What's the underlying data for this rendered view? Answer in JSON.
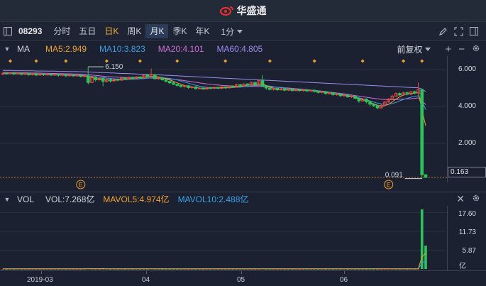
{
  "app": {
    "brand": "华盛通"
  },
  "toolbar": {
    "stock_code": "08293",
    "periods": [
      "分时",
      "五日",
      "日K",
      "周K",
      "月K",
      "季K",
      "年K"
    ],
    "period_select": "1分"
  },
  "main_legend": {
    "name": "MA",
    "ma5": "MA5:2.949",
    "ma10": "MA10:3.823",
    "ma20": "MA20:4.101",
    "ma60": "MA60:4.805",
    "adjust": "前复权"
  },
  "price_axis": [
    "6.000",
    "4.000",
    "2.000"
  ],
  "current_price": "0.163",
  "annotations": {
    "high": "6.150",
    "low": "0.091",
    "event_marker": "E"
  },
  "vol_legend": {
    "name": "VOL",
    "vol": "VOL:7.268亿",
    "mavol5": "MAVOL5:4.974亿",
    "mavol10": "MAVOL10:2.488亿"
  },
  "vol_axis": [
    "17.60",
    "11.73",
    "5.87",
    "亿"
  ],
  "time_axis": [
    "2019-03",
    "04",
    "05",
    "06"
  ],
  "colors": {
    "up": "#e04848",
    "down": "#2fc25b",
    "ma5": "#f0a030",
    "ma10": "#3aa0e8",
    "ma20": "#d070d8",
    "ma60": "#9b8cf0",
    "marker": "#f0a030"
  },
  "chart_data": {
    "type": "candlestick",
    "ylim": [
      0,
      6.5
    ],
    "candles": [
      [
        5.75,
        5.8,
        5.85,
        5.7
      ],
      [
        5.8,
        5.78,
        5.88,
        5.72
      ],
      [
        5.78,
        5.82,
        5.86,
        5.74
      ],
      [
        5.82,
        5.76,
        5.86,
        5.7
      ],
      [
        5.76,
        5.8,
        5.84,
        5.72
      ],
      [
        5.8,
        5.74,
        5.84,
        5.68
      ],
      [
        5.74,
        5.79,
        5.83,
        5.7
      ],
      [
        5.79,
        5.72,
        5.82,
        5.66
      ],
      [
        5.72,
        5.78,
        5.82,
        5.68
      ],
      [
        5.78,
        5.7,
        5.82,
        5.64
      ],
      [
        5.7,
        5.76,
        5.8,
        5.66
      ],
      [
        5.76,
        5.72,
        5.8,
        5.66
      ],
      [
        5.72,
        5.74,
        5.78,
        5.68
      ],
      [
        5.74,
        5.7,
        5.78,
        5.64
      ],
      [
        5.7,
        5.73,
        5.76,
        5.66
      ],
      [
        5.73,
        5.69,
        5.78,
        5.62
      ],
      [
        5.69,
        5.72,
        5.76,
        5.64
      ],
      [
        5.72,
        5.66,
        5.76,
        5.6
      ],
      [
        5.66,
        5.7,
        5.74,
        5.62
      ],
      [
        5.7,
        5.67,
        5.74,
        5.6
      ],
      [
        5.67,
        5.69,
        5.72,
        5.62
      ],
      [
        5.69,
        5.62,
        5.72,
        5.58
      ],
      [
        5.62,
        5.66,
        5.7,
        5.58
      ],
      [
        5.66,
        5.3,
        6.15,
        5.2
      ],
      [
        5.3,
        5.6,
        5.66,
        5.28
      ],
      [
        5.6,
        5.44,
        5.64,
        5.36
      ],
      [
        5.44,
        5.52,
        5.58,
        5.4
      ],
      [
        5.52,
        5.36,
        5.56,
        5.1
      ],
      [
        5.36,
        5.46,
        5.5,
        5.3
      ],
      [
        5.46,
        5.38,
        5.52,
        5.3
      ],
      [
        5.38,
        5.46,
        5.5,
        5.34
      ],
      [
        5.46,
        5.42,
        5.52,
        5.36
      ],
      [
        5.42,
        5.54,
        5.58,
        5.4
      ],
      [
        5.54,
        5.48,
        5.58,
        5.42
      ],
      [
        5.48,
        5.58,
        5.62,
        5.44
      ],
      [
        5.58,
        5.52,
        5.62,
        5.46
      ],
      [
        5.52,
        5.6,
        5.64,
        5.48
      ],
      [
        5.6,
        5.54,
        5.64,
        5.5
      ],
      [
        5.54,
        5.7,
        5.74,
        5.52
      ],
      [
        5.7,
        5.6,
        5.76,
        5.56
      ],
      [
        5.6,
        5.72,
        6.05,
        5.58
      ],
      [
        5.72,
        5.5,
        5.76,
        5.46
      ],
      [
        5.5,
        5.56,
        5.6,
        5.44
      ],
      [
        5.56,
        5.44,
        5.6,
        5.4
      ],
      [
        5.44,
        5.36,
        5.48,
        5.3
      ],
      [
        5.36,
        5.28,
        5.4,
        5.22
      ],
      [
        5.28,
        5.2,
        5.32,
        5.16
      ],
      [
        5.2,
        5.14,
        5.24,
        5.08
      ],
      [
        5.14,
        5.08,
        5.18,
        5.02
      ],
      [
        5.08,
        5.12,
        5.16,
        5.02
      ],
      [
        5.12,
        5.02,
        5.16,
        4.96
      ],
      [
        5.02,
        5.06,
        5.1,
        4.96
      ],
      [
        5.06,
        4.96,
        5.1,
        4.92
      ],
      [
        4.96,
        5.0,
        5.04,
        4.92
      ],
      [
        5.0,
        4.94,
        5.04,
        4.9
      ],
      [
        4.94,
        5.02,
        5.06,
        4.9
      ],
      [
        5.02,
        4.98,
        5.06,
        4.92
      ],
      [
        4.98,
        5.04,
        5.08,
        4.94
      ],
      [
        5.04,
        4.98,
        5.08,
        4.94
      ],
      [
        4.98,
        5.06,
        5.1,
        4.94
      ],
      [
        5.06,
        5.0,
        5.1,
        4.96
      ],
      [
        5.0,
        5.1,
        5.14,
        4.98
      ],
      [
        5.1,
        5.04,
        5.14,
        5.0
      ],
      [
        5.04,
        5.18,
        5.22,
        5.02
      ],
      [
        5.18,
        5.1,
        5.22,
        5.04
      ],
      [
        5.1,
        5.22,
        5.26,
        5.06
      ],
      [
        5.22,
        5.14,
        5.26,
        5.1
      ],
      [
        5.14,
        5.3,
        5.34,
        5.12
      ],
      [
        5.3,
        5.16,
        5.34,
        5.12
      ],
      [
        5.16,
        5.4,
        5.46,
        5.14
      ],
      [
        5.4,
        5.1,
        5.7,
        5.06
      ],
      [
        5.1,
        5.0,
        5.14,
        4.9
      ],
      [
        5.0,
        4.92,
        5.06,
        4.86
      ],
      [
        4.92,
        4.98,
        5.02,
        4.86
      ],
      [
        4.98,
        4.9,
        5.02,
        4.84
      ],
      [
        4.9,
        4.96,
        5.0,
        4.86
      ],
      [
        4.96,
        4.88,
        5.0,
        4.82
      ],
      [
        4.88,
        4.94,
        4.98,
        4.84
      ],
      [
        4.94,
        4.86,
        4.98,
        4.8
      ],
      [
        4.86,
        4.92,
        4.96,
        4.82
      ],
      [
        4.92,
        4.86,
        4.96,
        4.8
      ],
      [
        4.86,
        4.9,
        4.94,
        4.8
      ],
      [
        4.9,
        4.84,
        4.94,
        4.78
      ],
      [
        4.84,
        4.88,
        4.92,
        4.78
      ],
      [
        4.88,
        4.82,
        4.92,
        4.76
      ],
      [
        4.82,
        4.76,
        4.86,
        4.7
      ],
      [
        4.76,
        4.8,
        4.84,
        4.7
      ],
      [
        4.8,
        4.7,
        4.84,
        4.64
      ],
      [
        4.7,
        4.74,
        4.78,
        4.64
      ],
      [
        4.74,
        4.64,
        4.78,
        4.58
      ],
      [
        4.64,
        4.68,
        4.72,
        4.58
      ],
      [
        4.68,
        4.58,
        4.72,
        4.52
      ],
      [
        4.58,
        4.62,
        4.66,
        4.52
      ],
      [
        4.62,
        4.52,
        4.66,
        4.46
      ],
      [
        4.52,
        4.56,
        4.6,
        4.46
      ],
      [
        4.56,
        4.44,
        4.6,
        4.38
      ],
      [
        4.44,
        4.3,
        4.48,
        4.2
      ],
      [
        4.3,
        4.4,
        4.46,
        4.26
      ],
      [
        4.4,
        4.26,
        4.44,
        4.16
      ],
      [
        4.26,
        4.12,
        4.32,
        4.02
      ],
      [
        4.12,
        4.04,
        4.18,
        3.96
      ],
      [
        4.04,
        3.92,
        4.1,
        3.86
      ],
      [
        3.92,
        4.06,
        4.12,
        3.88
      ],
      [
        4.06,
        4.24,
        4.3,
        4.02
      ],
      [
        4.24,
        4.4,
        4.46,
        4.2
      ],
      [
        4.4,
        4.56,
        4.62,
        4.36
      ],
      [
        4.56,
        4.7,
        4.76,
        4.52
      ],
      [
        4.7,
        4.62,
        4.76,
        4.58
      ],
      [
        4.62,
        4.74,
        4.8,
        4.58
      ],
      [
        4.74,
        4.66,
        4.8,
        4.6
      ],
      [
        4.66,
        4.8,
        4.84,
        4.62
      ],
      [
        4.8,
        4.72,
        4.86,
        4.66
      ],
      [
        4.72,
        4.9,
        5.3,
        4.68
      ],
      [
        4.9,
        0.3,
        4.96,
        0.091
      ],
      [
        0.3,
        0.163,
        0.32,
        0.12
      ]
    ],
    "ma5": [
      5.78,
      5.78,
      5.78,
      5.78,
      5.78,
      5.77,
      5.76,
      5.75,
      5.75,
      5.74,
      5.74,
      5.73,
      5.73,
      5.72,
      5.72,
      5.71,
      5.71,
      5.7,
      5.7,
      5.69,
      5.68,
      5.67,
      5.66,
      5.6,
      5.56,
      5.52,
      5.48,
      5.45,
      5.43,
      5.42,
      5.42,
      5.44,
      5.46,
      5.48,
      5.5,
      5.53,
      5.55,
      5.58,
      5.6,
      5.62,
      5.64,
      5.63,
      5.6,
      5.56,
      5.5,
      5.44,
      5.36,
      5.28,
      5.2,
      5.14,
      5.1,
      5.06,
      5.03,
      5.0,
      4.99,
      4.99,
      5.0,
      5.01,
      5.02,
      5.02,
      5.03,
      5.04,
      5.06,
      5.08,
      5.1,
      5.12,
      5.15,
      5.18,
      5.21,
      5.22,
      5.2,
      5.14,
      5.06,
      4.98,
      4.94,
      4.92,
      4.91,
      4.9,
      4.89,
      4.88,
      4.88,
      4.87,
      4.86,
      4.85,
      4.84,
      4.82,
      4.79,
      4.76,
      4.73,
      4.7,
      4.66,
      4.63,
      4.6,
      4.57,
      4.53,
      4.48,
      4.42,
      4.36,
      4.3,
      4.22,
      4.14,
      4.06,
      4.02,
      4.04,
      4.12,
      4.25,
      4.4,
      4.52,
      4.62,
      4.68,
      4.7,
      4.72,
      4.76,
      3.8,
      2.949
    ],
    "ma10": [
      5.8,
      5.8,
      5.79,
      5.79,
      5.79,
      5.78,
      5.78,
      5.77,
      5.77,
      5.76,
      5.76,
      5.75,
      5.75,
      5.74,
      5.74,
      5.73,
      5.73,
      5.72,
      5.72,
      5.71,
      5.71,
      5.7,
      5.69,
      5.66,
      5.63,
      5.6,
      5.58,
      5.56,
      5.54,
      5.52,
      5.5,
      5.48,
      5.47,
      5.46,
      5.46,
      5.47,
      5.48,
      5.5,
      5.51,
      5.53,
      5.55,
      5.56,
      5.56,
      5.55,
      5.54,
      5.52,
      5.48,
      5.44,
      5.38,
      5.32,
      5.26,
      5.2,
      5.15,
      5.1,
      5.07,
      5.04,
      5.02,
      5.01,
      5.01,
      5.01,
      5.01,
      5.02,
      5.03,
      5.04,
      5.05,
      5.07,
      5.09,
      5.11,
      5.13,
      5.14,
      5.14,
      5.12,
      5.1,
      5.07,
      5.04,
      5.02,
      5.0,
      4.98,
      4.96,
      4.94,
      4.92,
      4.91,
      4.9,
      4.88,
      4.86,
      4.85,
      4.82,
      4.8,
      4.77,
      4.74,
      4.71,
      4.67,
      4.64,
      4.6,
      4.56,
      4.52,
      4.47,
      4.42,
      4.36,
      4.3,
      4.24,
      4.18,
      4.14,
      4.12,
      4.12,
      4.16,
      4.22,
      4.3,
      4.38,
      4.44,
      4.5,
      4.54,
      4.58,
      4.3,
      3.823
    ],
    "ma20": [
      5.85,
      5.85,
      5.84,
      5.84,
      5.84,
      5.83,
      5.83,
      5.82,
      5.82,
      5.81,
      5.81,
      5.8,
      5.8,
      5.79,
      5.79,
      5.78,
      5.78,
      5.77,
      5.77,
      5.76,
      5.76,
      5.75,
      5.74,
      5.72,
      5.7,
      5.68,
      5.66,
      5.64,
      5.62,
      5.61,
      5.6,
      5.59,
      5.58,
      5.57,
      5.56,
      5.55,
      5.55,
      5.54,
      5.54,
      5.54,
      5.54,
      5.53,
      5.52,
      5.51,
      5.5,
      5.49,
      5.47,
      5.45,
      5.43,
      5.4,
      5.37,
      5.34,
      5.31,
      5.28,
      5.25,
      5.22,
      5.2,
      5.18,
      5.16,
      5.14,
      5.13,
      5.12,
      5.11,
      5.1,
      5.09,
      5.09,
      5.09,
      5.09,
      5.09,
      5.08,
      5.08,
      5.07,
      5.06,
      5.05,
      5.04,
      5.03,
      5.01,
      5.0,
      4.98,
      4.96,
      4.95,
      4.93,
      4.91,
      4.89,
      4.87,
      4.85,
      4.83,
      4.81,
      4.78,
      4.76,
      4.73,
      4.71,
      4.68,
      4.65,
      4.62,
      4.59,
      4.56,
      4.53,
      4.5,
      4.47,
      4.44,
      4.41,
      4.39,
      4.38,
      4.37,
      4.37,
      4.38,
      4.39,
      4.4,
      4.41,
      4.42,
      4.44,
      4.46,
      4.3,
      4.101
    ],
    "ma60": [
      5.95,
      5.95,
      5.95,
      5.94,
      5.94,
      5.94,
      5.93,
      5.93,
      5.93,
      5.92,
      5.92,
      5.92,
      5.91,
      5.91,
      5.91,
      5.9,
      5.9,
      5.9,
      5.89,
      5.89,
      5.89,
      5.88,
      5.88,
      5.87,
      5.86,
      5.85,
      5.84,
      5.84,
      5.83,
      5.82,
      5.81,
      5.8,
      5.79,
      5.79,
      5.78,
      5.77,
      5.76,
      5.75,
      5.74,
      5.73,
      5.73,
      5.72,
      5.71,
      5.7,
      5.69,
      5.68,
      5.67,
      5.66,
      5.65,
      5.64,
      5.63,
      5.62,
      5.61,
      5.6,
      5.59,
      5.58,
      5.57,
      5.56,
      5.55,
      5.54,
      5.53,
      5.52,
      5.51,
      5.5,
      5.49,
      5.48,
      5.47,
      5.46,
      5.45,
      5.44,
      5.43,
      5.42,
      5.41,
      5.4,
      5.39,
      5.38,
      5.37,
      5.36,
      5.35,
      5.34,
      5.33,
      5.32,
      5.31,
      5.3,
      5.29,
      5.28,
      5.27,
      5.26,
      5.25,
      5.24,
      5.23,
      5.22,
      5.21,
      5.2,
      5.19,
      5.18,
      5.17,
      5.16,
      5.15,
      5.14,
      5.13,
      5.12,
      5.11,
      5.1,
      5.09,
      5.08,
      5.07,
      5.06,
      5.05,
      5.04,
      5.03,
      5.02,
      5.01,
      4.95,
      4.805
    ],
    "volume": [
      0.05,
      0.04,
      0.05,
      0.04,
      0.06,
      0.05,
      0.04,
      0.05,
      0.04,
      0.05,
      0.04,
      0.05,
      0.04,
      0.05,
      0.04,
      0.05,
      0.04,
      0.05,
      0.04,
      0.05,
      0.04,
      0.05,
      0.06,
      0.2,
      0.08,
      0.06,
      0.05,
      0.08,
      0.05,
      0.04,
      0.05,
      0.04,
      0.05,
      0.04,
      0.05,
      0.04,
      0.05,
      0.04,
      0.05,
      0.04,
      0.12,
      0.06,
      0.05,
      0.04,
      0.05,
      0.04,
      0.05,
      0.04,
      0.05,
      0.04,
      0.05,
      0.04,
      0.05,
      0.04,
      0.05,
      0.04,
      0.05,
      0.04,
      0.05,
      0.04,
      0.05,
      0.04,
      0.05,
      0.04,
      0.05,
      0.04,
      0.05,
      0.04,
      0.05,
      0.06,
      0.14,
      0.06,
      0.05,
      0.04,
      0.05,
      0.04,
      0.05,
      0.04,
      0.05,
      0.04,
      0.05,
      0.04,
      0.05,
      0.04,
      0.05,
      0.04,
      0.05,
      0.04,
      0.05,
      0.04,
      0.05,
      0.04,
      0.05,
      0.04,
      0.05,
      0.04,
      0.05,
      0.04,
      0.05,
      0.06,
      0.05,
      0.04,
      0.05,
      0.06,
      0.08,
      0.07,
      0.06,
      0.05,
      0.06,
      0.05,
      0.06,
      0.05,
      0.1,
      18.6,
      7.268
    ],
    "mavol5": [
      0.05,
      0.05,
      0.05,
      0.05,
      0.05,
      0.05,
      0.05,
      0.05,
      0.05,
      0.05,
      0.05,
      0.05,
      0.05,
      0.05,
      0.05,
      0.05,
      0.05,
      0.05,
      0.05,
      0.05,
      0.05,
      0.05,
      0.05,
      0.08,
      0.09,
      0.09,
      0.09,
      0.1,
      0.06,
      0.06,
      0.05,
      0.05,
      0.05,
      0.05,
      0.05,
      0.05,
      0.05,
      0.05,
      0.05,
      0.05,
      0.06,
      0.06,
      0.06,
      0.06,
      0.06,
      0.05,
      0.05,
      0.05,
      0.05,
      0.05,
      0.05,
      0.05,
      0.05,
      0.05,
      0.05,
      0.05,
      0.05,
      0.05,
      0.05,
      0.05,
      0.05,
      0.05,
      0.05,
      0.05,
      0.05,
      0.05,
      0.05,
      0.05,
      0.05,
      0.05,
      0.07,
      0.07,
      0.07,
      0.07,
      0.07,
      0.05,
      0.05,
      0.05,
      0.05,
      0.05,
      0.05,
      0.05,
      0.05,
      0.05,
      0.05,
      0.05,
      0.05,
      0.05,
      0.05,
      0.05,
      0.05,
      0.05,
      0.05,
      0.05,
      0.05,
      0.05,
      0.05,
      0.05,
      0.05,
      0.05,
      0.05,
      0.05,
      0.05,
      0.05,
      0.06,
      0.06,
      0.06,
      0.06,
      0.06,
      0.06,
      0.06,
      0.06,
      0.06,
      3.75,
      4.974
    ],
    "mavol10": [
      0.05,
      0.05,
      0.05,
      0.05,
      0.05,
      0.05,
      0.05,
      0.05,
      0.05,
      0.05,
      0.05,
      0.05,
      0.05,
      0.05,
      0.05,
      0.05,
      0.05,
      0.05,
      0.05,
      0.05,
      0.05,
      0.05,
      0.05,
      0.06,
      0.07,
      0.07,
      0.07,
      0.07,
      0.07,
      0.07,
      0.07,
      0.07,
      0.07,
      0.07,
      0.06,
      0.05,
      0.05,
      0.05,
      0.05,
      0.05,
      0.06,
      0.06,
      0.06,
      0.06,
      0.06,
      0.06,
      0.06,
      0.06,
      0.06,
      0.06,
      0.05,
      0.05,
      0.05,
      0.05,
      0.05,
      0.05,
      0.05,
      0.05,
      0.05,
      0.05,
      0.05,
      0.05,
      0.05,
      0.05,
      0.05,
      0.05,
      0.05,
      0.05,
      0.05,
      0.05,
      0.06,
      0.06,
      0.06,
      0.06,
      0.06,
      0.06,
      0.06,
      0.06,
      0.06,
      0.06,
      0.05,
      0.05,
      0.05,
      0.05,
      0.05,
      0.05,
      0.05,
      0.05,
      0.05,
      0.05,
      0.05,
      0.05,
      0.05,
      0.05,
      0.05,
      0.05,
      0.05,
      0.05,
      0.05,
      0.05,
      0.05,
      0.05,
      0.05,
      0.05,
      0.05,
      0.06,
      0.06,
      0.06,
      0.06,
      0.06,
      0.06,
      0.06,
      0.06,
      1.92,
      2.488
    ],
    "vol_ylim": [
      0,
      19.5
    ],
    "markers_top": [
      2,
      9,
      17,
      28,
      37,
      47,
      60,
      72,
      84,
      97,
      108,
      113
    ],
    "event_markers": [
      21,
      104
    ]
  }
}
